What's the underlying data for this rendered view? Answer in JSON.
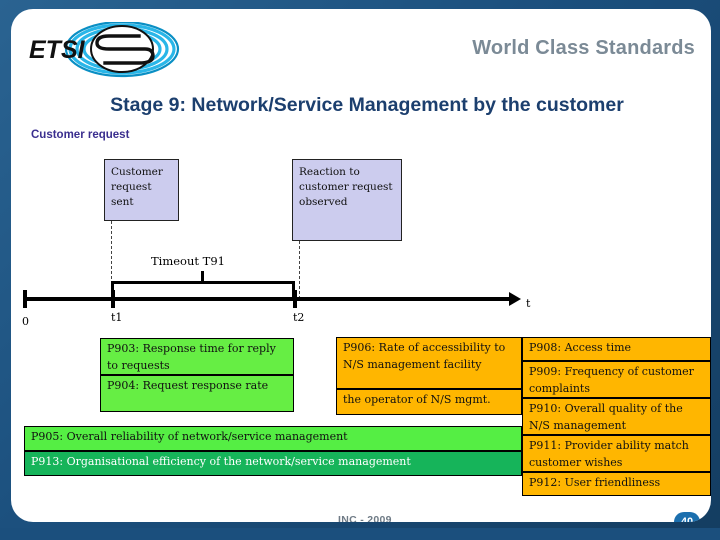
{
  "header": {
    "logo_text": "ETSI",
    "tagline": "World Class Standards",
    "title": "Stage 9: Network/Service Management by the customer",
    "subtitle": "Customer request"
  },
  "diagram": {
    "event_boxes": [
      {
        "id": "request",
        "text": "Customer request sent"
      },
      {
        "id": "reaction",
        "text": "Reaction to customer request observed"
      }
    ],
    "timeout_label": "Timeout T91",
    "axis_label": "t",
    "ticks": [
      {
        "id": "zero",
        "label": "0"
      },
      {
        "id": "t1",
        "label": "t1"
      },
      {
        "id": "t2",
        "label": "t2"
      }
    ]
  },
  "metrics": {
    "green_left": [
      {
        "id": "P903",
        "text": "P903: Response time for reply to requests"
      },
      {
        "id": "P904",
        "text": "P904: Request response rate"
      }
    ],
    "orange_middle": [
      {
        "id": "P906",
        "text": "P906: Rate of accessibility to N/S management facility"
      },
      {
        "id": "P907",
        "text": "the operator of N/S mgmt."
      }
    ],
    "orange_right": [
      {
        "id": "P908",
        "text": "P908: Access time"
      },
      {
        "id": "P909",
        "text": "P909: Frequency of customer complaints"
      },
      {
        "id": "P910",
        "text": "P910: Overall quality of the N/S management"
      },
      {
        "id": "P911",
        "text": "P911: Provider ability match customer wishes"
      },
      {
        "id": "P912",
        "text": "P912: User friendliness"
      }
    ],
    "banners": [
      {
        "id": "P905",
        "text": "P905: Overall reliability of network/service management"
      },
      {
        "id": "P913",
        "text": "P913: Organisational efficiency of the network/service management"
      }
    ]
  },
  "footer": {
    "note": "INC - 2009",
    "page_number": "40"
  },
  "colors": {
    "frame_blue": "#1b4f7d",
    "title_blue": "#1c3f6e",
    "subtitle_purple": "#3b2f8f",
    "tagline_gray": "#7b8a96",
    "event_box_fill": "#ccccee",
    "green": "#66ee44",
    "light_green": "#55ee44",
    "dark_green": "#16b45a",
    "orange": "#ffb600",
    "badge_blue": "#1b6fae"
  }
}
